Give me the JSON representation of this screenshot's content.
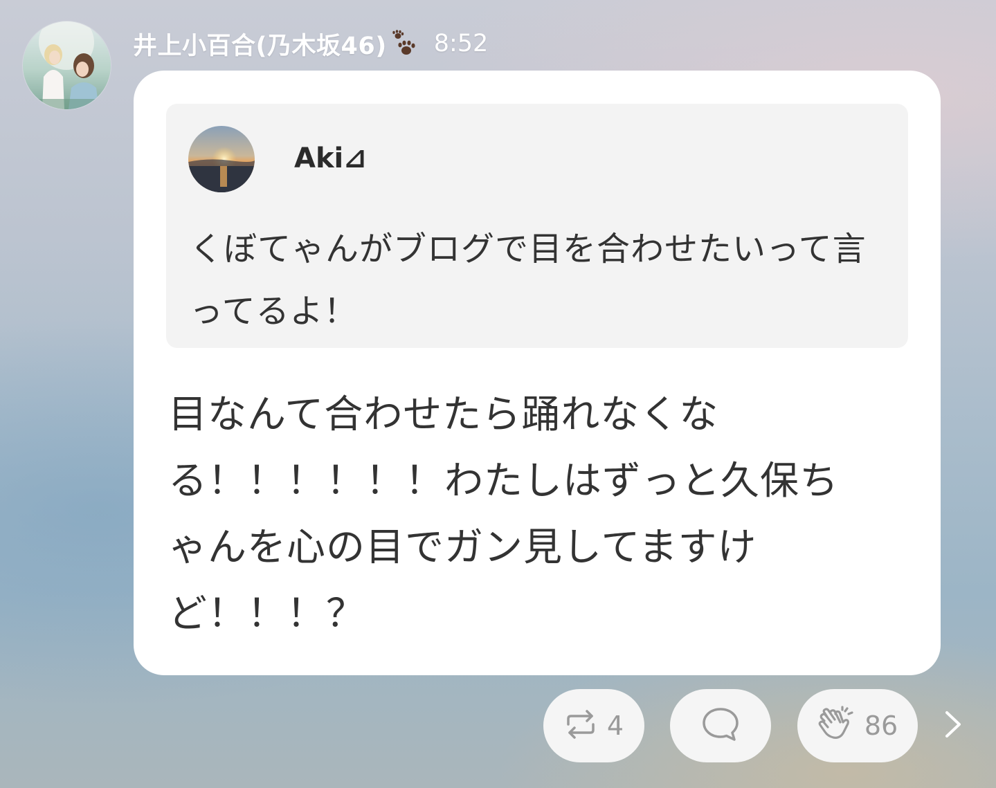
{
  "post": {
    "sender_name": "井上小百合(乃木坂46)",
    "time": "8:52",
    "quote": {
      "author": "Aki⊿",
      "text": "くぼてゃんがブログで目を合わせたいって言ってるよ！"
    },
    "message": "目なんて合わせたら踊れなくなる！！！！！！わたしはずっと久保ちゃんを心の目でガン見してますけど！！！？"
  },
  "actions": {
    "repost_count": "4",
    "clap_count": "86"
  },
  "icons": {
    "name_badge": "paw-prints-icon",
    "repost": "repost-icon",
    "comment": "comment-bubble-icon",
    "clap": "clapping-hands-icon",
    "more": "chevron-right-icon"
  },
  "colors": {
    "bubble": "#ffffff",
    "quote_background": "#f3f3f3",
    "text": "#333333",
    "button_background": "#f5f5f5",
    "button_icon": "#9a9a9a"
  }
}
